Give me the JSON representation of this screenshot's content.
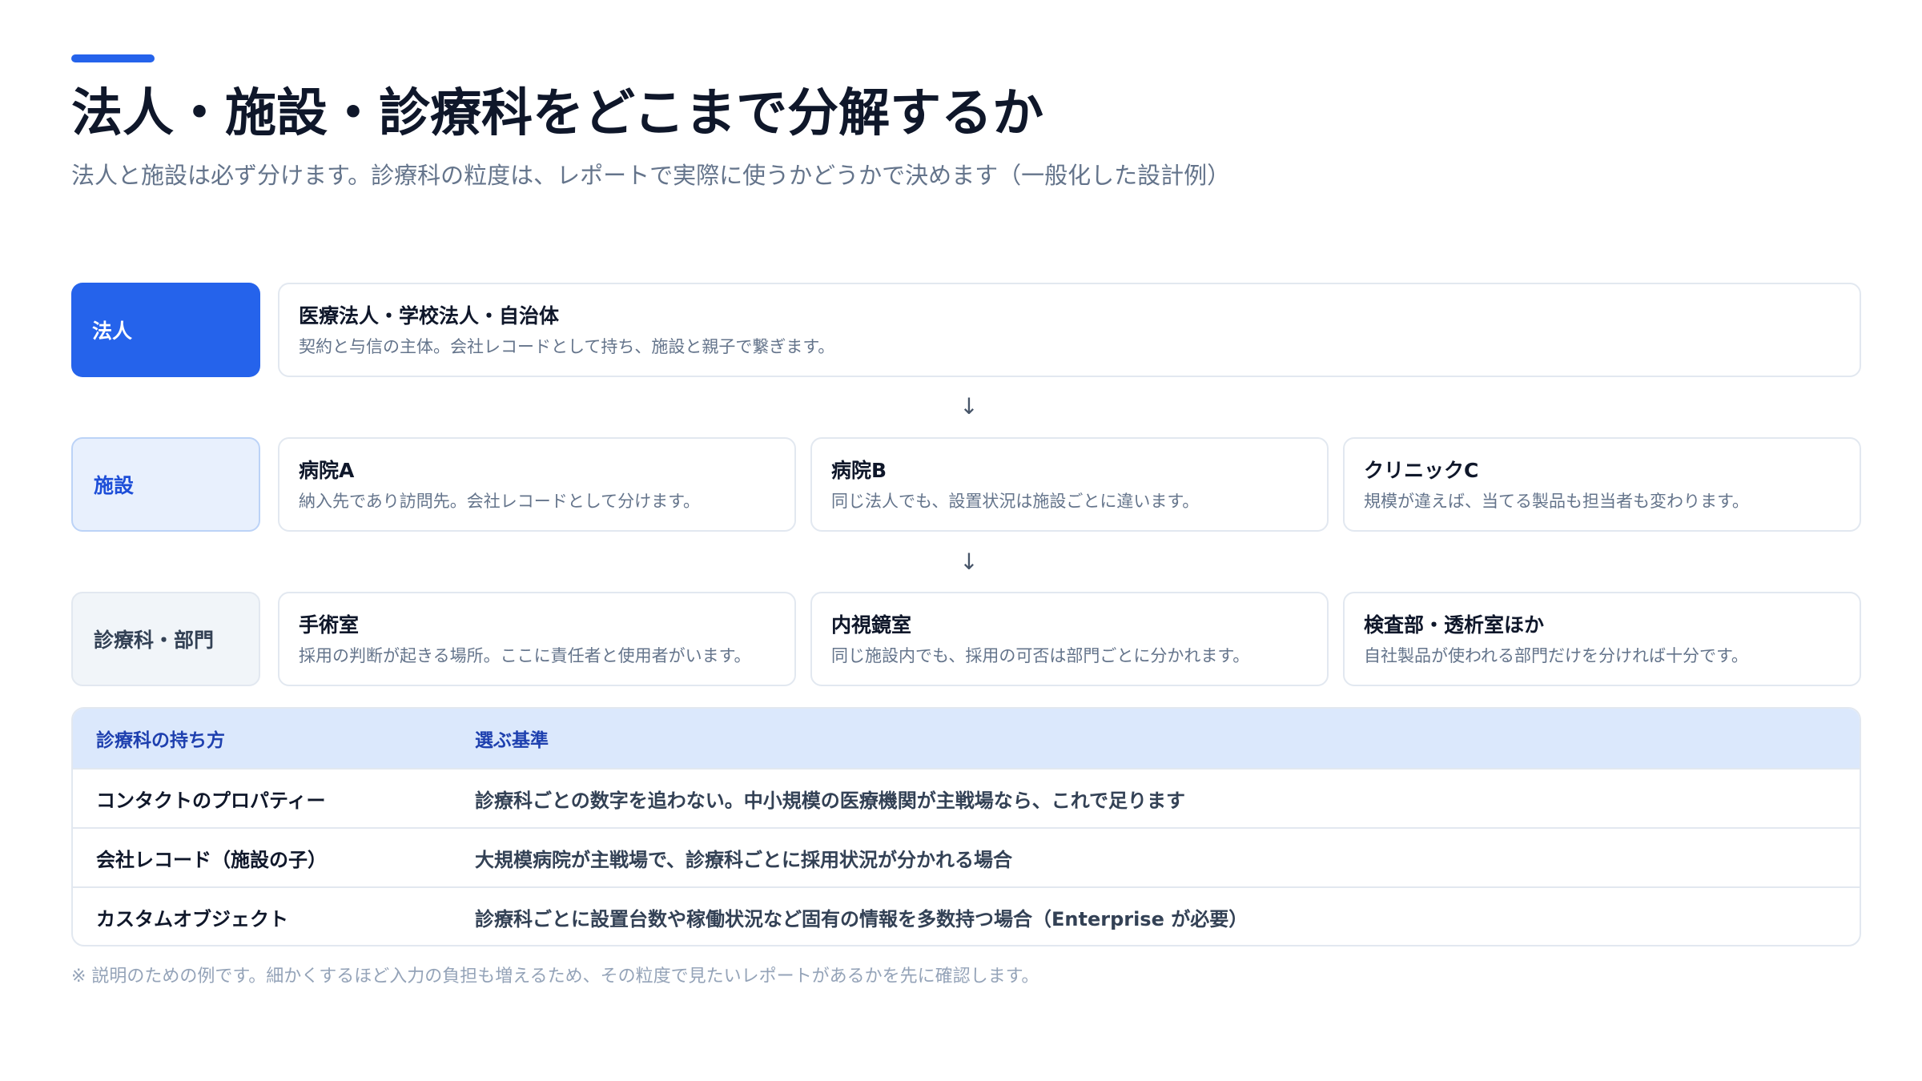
{
  "header": {
    "title": "法人・施設・診療科をどこまで分解するか",
    "subtitle": "法人と施設は必ず分けます。診療科の粒度は、レポートで実際に使うかどうかで決めます（一般化した設計例）"
  },
  "hierarchy": {
    "rows": [
      {
        "label": "法人",
        "cards": [
          {
            "title": "医療法人・学校法人・自治体",
            "desc": "契約と与信の主体。会社レコードとして持ち、施設と親子で繋ぎます。"
          }
        ]
      },
      {
        "label": "施設",
        "cards": [
          {
            "title": "病院A",
            "desc": "納入先であり訪問先。会社レコードとして分けます。"
          },
          {
            "title": "病院B",
            "desc": "同じ法人でも、設置状況は施設ごとに違います。"
          },
          {
            "title": "クリニックC",
            "desc": "規模が違えば、当てる製品も担当者も変わります。"
          }
        ]
      },
      {
        "label": "診療科・部門",
        "cards": [
          {
            "title": "手術室",
            "desc": "採用の判断が起きる場所。ここに責任者と使用者がいます。"
          },
          {
            "title": "内視鏡室",
            "desc": "同じ施設内でも、採用の可否は部門ごとに分かれます。"
          },
          {
            "title": "検査部・透析室ほか",
            "desc": "自社製品が使われる部門だけを分ければ十分です。"
          }
        ]
      }
    ],
    "arrow": "↓"
  },
  "table": {
    "headers": [
      "診療科の持ち方",
      "選ぶ基準"
    ],
    "rows": [
      [
        "コンタクトのプロパティー",
        "診療科ごとの数字を追わない。中小規模の医療機関が主戦場なら、これで足ります"
      ],
      [
        "会社レコード（施設の子）",
        "大規模病院が主戦場で、診療科ごとに採用状況が分かれる場合"
      ],
      [
        "カスタムオブジェクト",
        "診療科ごとに設置台数や稼働状況など固有の情報を多数持つ場合（Enterprise が必要）"
      ]
    ]
  },
  "footnote": "※ 説明のための例です。細かくするほど入力の負担も増えるため、その粒度で見たいレポートがあるかを先に確認します。",
  "colors": {
    "accent": "#2563eb",
    "title": "#0f172a",
    "muted": "#64748b",
    "table_header_bg": "#dbe8fc"
  }
}
